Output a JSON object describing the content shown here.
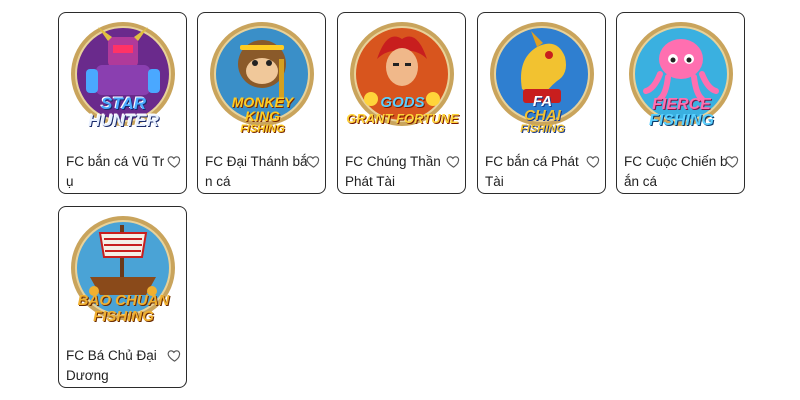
{
  "games": [
    {
      "name": "FC bắn cá Vũ Trụ",
      "logo": [
        "STAR",
        "HUNTER"
      ],
      "art": "robot-icon",
      "bg": "#6a2a8c",
      "accent": "#4aa8ff",
      "favorite_icon": "heart-outline-icon"
    },
    {
      "name": "FC Đại Thánh bắn cá",
      "logo": [
        "MONKEY",
        "KING",
        "FISHING"
      ],
      "art": "monkey-icon",
      "bg": "#3a8fc8",
      "accent": "#ffcc22",
      "favorite_icon": "heart-outline-icon"
    },
    {
      "name": "FC Chúng Thần Phát Tài",
      "logo": [
        "GODS",
        "GRANT FORTUNE"
      ],
      "art": "warrior-icon",
      "bg": "#d8551e",
      "accent": "#ffd43a",
      "favorite_icon": "heart-outline-icon"
    },
    {
      "name": "FC bắn cá Phát Tài",
      "logo": [
        "FA",
        "CHAI",
        "FISHING"
      ],
      "art": "golden-dragon-icon",
      "bg": "#2f7fd0",
      "accent": "#f2c230",
      "favorite_icon": "heart-outline-icon"
    },
    {
      "name": "FC Cuộc Chiến bắn cá",
      "logo": [
        "FIERCE",
        "FISHING"
      ],
      "art": "octopus-icon",
      "bg": "#3ab0e0",
      "accent": "#ff6fb0",
      "favorite_icon": "heart-outline-icon"
    },
    {
      "name": "FC Bá Chủ Đại Dương",
      "logo": [
        "BAO CHUAN",
        "FISHING"
      ],
      "art": "pirate-ship-icon",
      "bg": "#4aa3d6",
      "accent": "#f0b030",
      "favorite_icon": "heart-outline-icon"
    }
  ],
  "colors": {
    "card_border": "#2b2b2b",
    "text": "#222222",
    "ring": "#c9a45c"
  }
}
